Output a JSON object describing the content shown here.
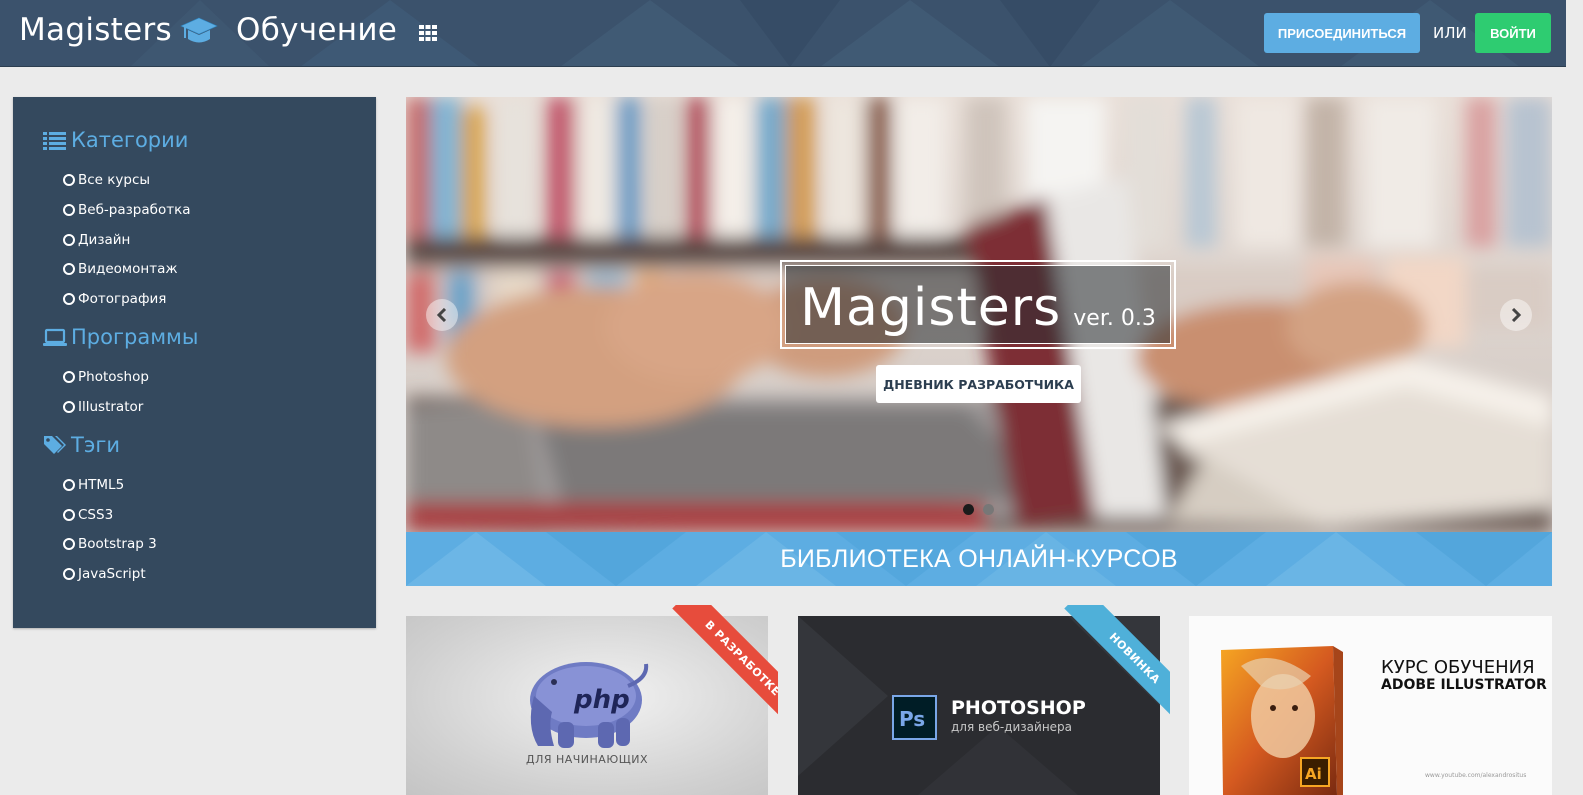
{
  "header": {
    "brand_left": "Magisters",
    "brand_right": "Обучение",
    "join_label": "ПРИСОЕДИНИТЬСЯ",
    "or_label": "ИЛИ",
    "login_label": "ВОЙТИ"
  },
  "sidebar": {
    "categories": {
      "title": "Категории",
      "icon": "list-icon",
      "items": [
        "Все курсы",
        "Веб-разработка",
        "Дизайн",
        "Видеомонтаж",
        "Фотография"
      ]
    },
    "programs": {
      "title": "Программы",
      "icon": "laptop-icon",
      "items": [
        "Photoshop",
        "Illustrator"
      ]
    },
    "tags": {
      "title": "Тэги",
      "icon": "tags-icon",
      "items": [
        "HTML5",
        "CSS3",
        "Bootstrap 3",
        "JavaScript"
      ]
    }
  },
  "carousel": {
    "title": "Magisters",
    "version": "ver. 0.3",
    "button_label": "ДНЕВНИК РАЗРАБОТЧИКА",
    "slides": 2,
    "active_slide": 1
  },
  "banner": {
    "text": "БИБЛИОТЕКА ОНЛАЙН-КУРСОВ"
  },
  "courses": [
    {
      "ribbon": "В РАЗРАБОТКЕ",
      "logo_text": "php",
      "subtitle": "ДЛЯ НАЧИНАЮЩИХ"
    },
    {
      "ribbon": "НОВИНКА",
      "logo_text": "Ps",
      "title": "PHOTOSHOP",
      "subtitle": "для веб-дизайнера"
    },
    {
      "logo_text": "Ai",
      "title_line1": "КУРС ОБУЧЕНИЯ",
      "title_line2": "ADOBE ILLUSTRATOR",
      "url": "www.youtube.com/alexandrositus"
    }
  ],
  "colors": {
    "navbar": "#3b526c",
    "sidebar": "#34495e",
    "accent_blue": "#5dade2",
    "accent_green": "#2ecc71",
    "ribbon_red": "#e74c3c",
    "ribbon_blue": "#4fb0d9"
  }
}
